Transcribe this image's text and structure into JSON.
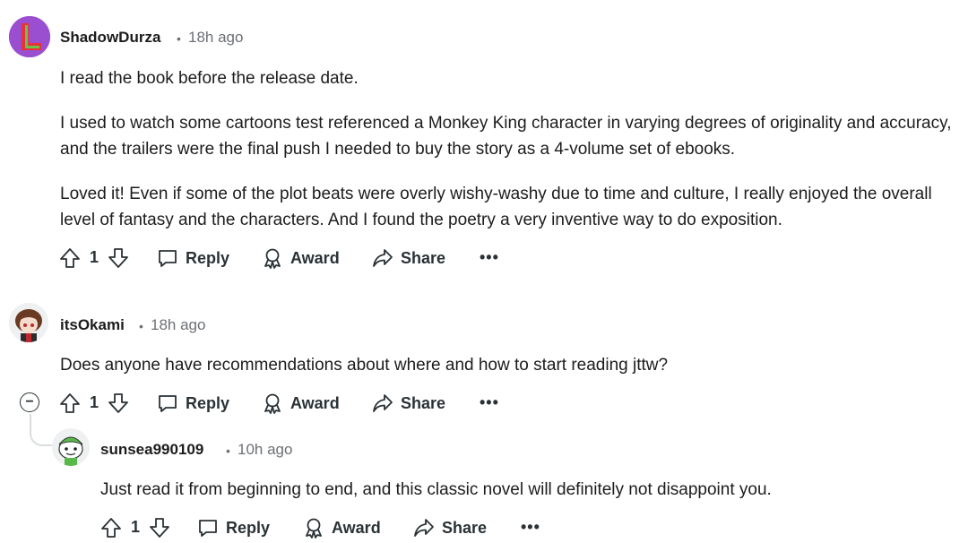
{
  "comments": [
    {
      "author": "ShadowDurza",
      "time": "18h ago",
      "paragraphs": [
        "I read the book before the release date.",
        "I used to watch some cartoons test referenced a Monkey King character in varying degrees of originality and accuracy, and the trailers were the final push I needed to buy the story as a 4-volume set of ebooks.",
        "Loved it! Even if some of the plot beats were overly wishy-washy due to time and culture, I really enjoyed the overall level of fantasy and the characters. And I found the poetry a very inventive way to do exposition."
      ],
      "votes": "1",
      "reply_label": "Reply",
      "award_label": "Award",
      "share_label": "Share",
      "more_label": "•••"
    },
    {
      "author": "itsOkami",
      "time": "18h ago",
      "paragraphs": [
        "Does anyone have recommendations about where and how to start reading jttw?"
      ],
      "votes": "1",
      "reply_label": "Reply",
      "award_label": "Award",
      "share_label": "Share",
      "more_label": "•••",
      "collapse_symbol": "−"
    },
    {
      "author": "sunsea990109",
      "time": "10h ago",
      "paragraphs": [
        "Just read it from beginning to end, and this classic novel will definitely not disappoint you."
      ],
      "votes": "1",
      "reply_label": "Reply",
      "award_label": "Award",
      "share_label": "Share",
      "more_label": "•••"
    }
  ],
  "separator": "•",
  "colors": {
    "text": "#1c1c1c",
    "meta": "#6c7075",
    "action": "#2a3236",
    "thread_line": "#d9dde0"
  }
}
